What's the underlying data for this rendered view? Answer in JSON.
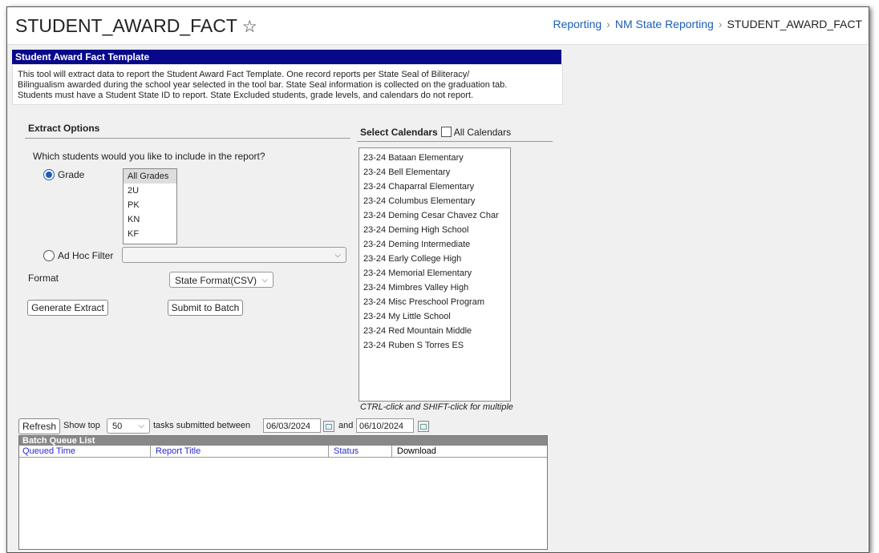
{
  "header": {
    "title": "STUDENT_AWARD_FACT",
    "breadcrumb": [
      "Reporting",
      "NM State Reporting",
      "STUDENT_AWARD_FACT"
    ]
  },
  "panel": {
    "title": "Student Award Fact Template",
    "description": [
      "This tool will extract data to report the Student Award Fact Template. One record reports per State Seal of Biliteracy/",
      "Bilingualism awarded during the school year selected in the tool bar. State Seal information is collected on the graduation tab.",
      "Students must have a Student State ID to report. State Excluded students, grade levels, and calendars do not report."
    ]
  },
  "extract": {
    "section_title": "Extract Options",
    "question": "Which students would you like to include in the report?",
    "grade_label": "Grade",
    "grades": [
      "All Grades",
      "2U",
      "PK",
      "KN",
      "KF"
    ],
    "adhoc_label": "Ad Hoc Filter",
    "adhoc_value": "",
    "format_label": "Format",
    "format_value": "State Format(CSV)",
    "generate_label": "Generate Extract",
    "batch_label": "Submit to Batch"
  },
  "calendars": {
    "title": "Select Calendars",
    "all_label": "All Calendars",
    "items": [
      "23-24 Bataan Elementary",
      "23-24 Bell Elementary",
      "23-24 Chaparral Elementary",
      "23-24 Columbus Elementary",
      "23-24 Deming Cesar Chavez Char",
      "23-24 Deming High School",
      "23-24 Deming Intermediate",
      "23-24 Early College High",
      "23-24 Memorial Elementary",
      "23-24 Mimbres Valley High",
      "23-24 Misc Preschool Program",
      "23-24 My Little School",
      "23-24 Red Mountain Middle",
      "23-24 Ruben S Torres ES"
    ],
    "hint": "CTRL-click and SHIFT-click for multiple"
  },
  "batch": {
    "refresh_label": "Refresh",
    "show_top_label": "Show top",
    "show_top_value": "50",
    "between_label": "tasks submitted between",
    "start_date": "06/03/2024",
    "and_label": "and",
    "end_date": "06/10/2024",
    "list_title": "Batch Queue List",
    "columns": [
      "Queued Time",
      "Report Title",
      "Status",
      "Download"
    ]
  },
  "colors": {
    "header_blue": "#08088a",
    "link_blue": "#1a5fb4"
  }
}
